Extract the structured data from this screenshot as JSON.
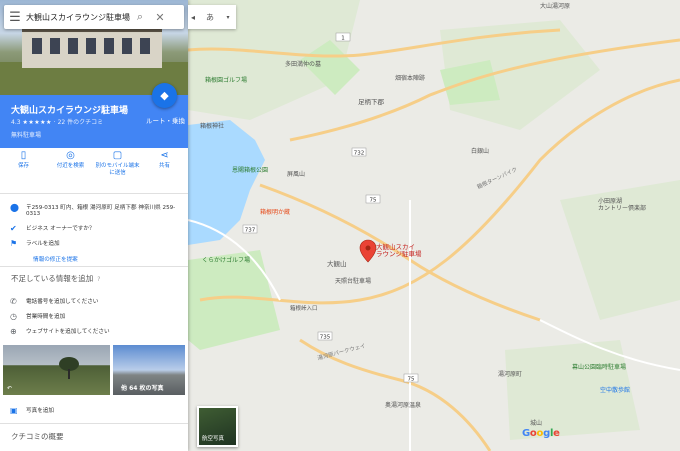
{
  "search": {
    "value": "大観山スカイラウンジ駐車場"
  },
  "lang_button": "あ",
  "place": {
    "name": "大観山スカイラウンジ駐車場",
    "rating": "4.3",
    "stars": "★★★★★",
    "reviews": "· 22 件のクチコミ",
    "category": "無料駐車場",
    "directions_label": "ルート・乗換"
  },
  "actions": [
    {
      "icon": "bookmark-icon",
      "label": "保存"
    },
    {
      "icon": "nearby-icon",
      "label": "付近を検索"
    },
    {
      "icon": "phone-send-icon",
      "label": "別のモバイル端末に送信"
    },
    {
      "icon": "share-icon",
      "label": "共有"
    }
  ],
  "info": {
    "address": "〒259-0313 町内、箱根 湯河原町 足柄下郡 神奈川県 259-0313",
    "owner": "ビジネス オーナーですか？",
    "label": "ラベルを追加",
    "suggest": "情報の修正を提案"
  },
  "missing": {
    "title": "不足している情報を追加",
    "phone": "電話番号を追加してください",
    "hours": "営業時間を追加",
    "website": "ウェブサイトを追加してください"
  },
  "photos": {
    "more": "他 64 枚の写真",
    "add": "写真を追加"
  },
  "reviews_title": "クチコミの概要",
  "satellite_label": "航空写真",
  "map_labels": {
    "pin": "大観山スカイ\nラウンジ駐車場",
    "hakone_golf": "箱根園ゴルフ場",
    "tada": "多田満仲の墓",
    "hatajuku": "畑宿本陣跡",
    "ashigara": "足柄下郡",
    "hakone_shrine": "箱根神社",
    "byakugin": "白銀山",
    "hakone_park": "恩賜箱根公園",
    "byobu": "屏風山",
    "hakone_meiko": "箱根明か蔵",
    "taikan": "大観山",
    "kurakake_golf": "くらかけゴルフ場",
    "tenbo": "天照台駐車場",
    "yugawara": "湯河原町",
    "okuyu": "奥湯河原温泉",
    "odawara_club": "小田原湖\nカントリー倶楽部",
    "makuyama": "幕山公園臨時駐車場",
    "shiroyama": "城山",
    "sorachu": "空中散歩館",
    "oyama": "大山湯河原",
    "turnpike": "箱根ターンパイク",
    "skyway": "湯河原パークウェイ",
    "route1": "1",
    "route732": "732",
    "route75": "75",
    "route737": "737",
    "route735": "735",
    "route75b": "75",
    "nishi": "箱根峠入口"
  },
  "colors": {
    "header": "#4285f4",
    "accent": "#1a73e8",
    "road": "#f6ce88",
    "water": "#aadaff",
    "park": "#cdebc0"
  }
}
